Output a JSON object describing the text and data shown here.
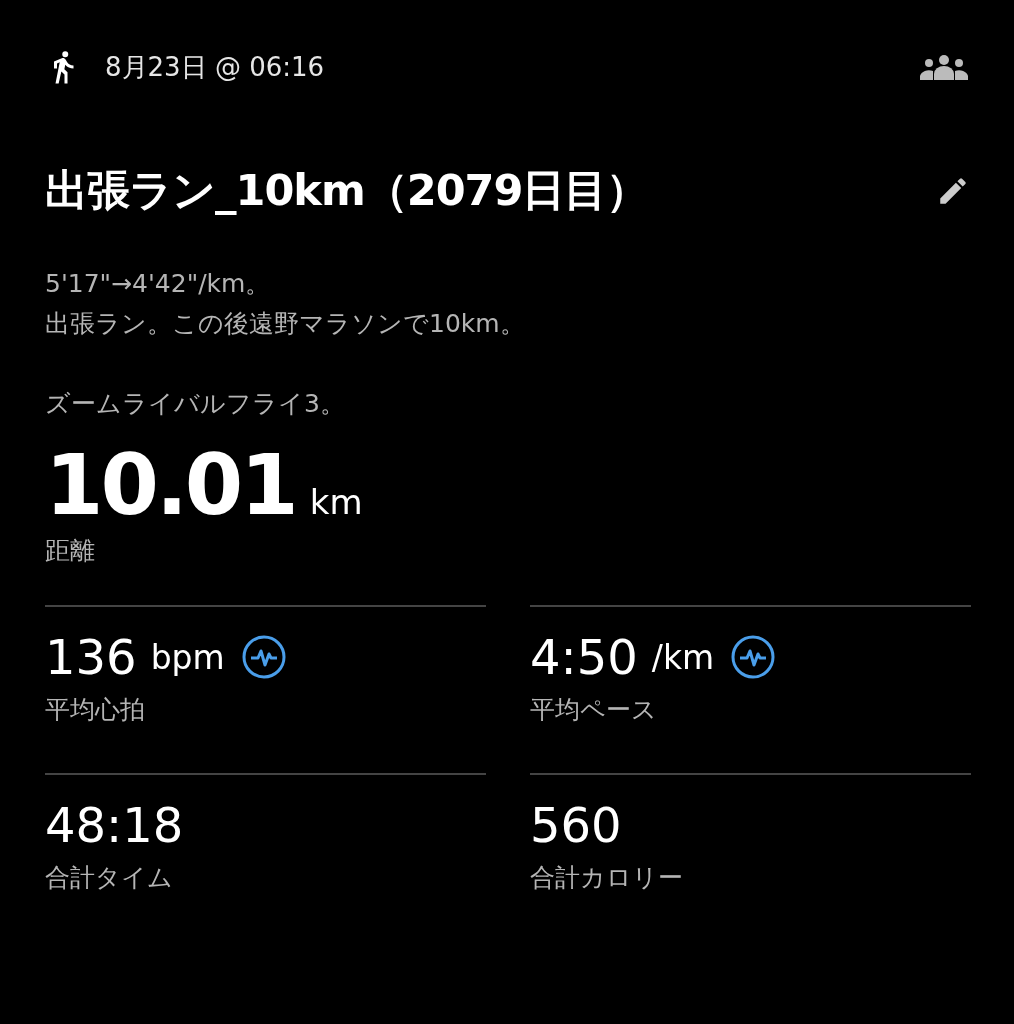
{
  "header": {
    "datetime": "8月23日 @ 06:16"
  },
  "title": "出張ラン_10km（2079日目）",
  "description": [
    [
      "5'17\"→4'42\"/km。",
      "出張ラン。この後遠野マラソンで10km。"
    ],
    [
      "ズームライバルフライ3。"
    ]
  ],
  "distance": {
    "value": "10.01",
    "unit": "km",
    "label": "距離"
  },
  "stats": [
    {
      "value": "136",
      "unit": "bpm",
      "label": "平均心拍",
      "chart_link": true
    },
    {
      "value": "4:50",
      "unit": "/km",
      "label": "平均ペース",
      "chart_link": true
    },
    {
      "value": "48:18",
      "label": "合計タイム",
      "chart_link": false
    },
    {
      "value": "560",
      "label": "合計カロリー",
      "chart_link": false
    }
  ]
}
